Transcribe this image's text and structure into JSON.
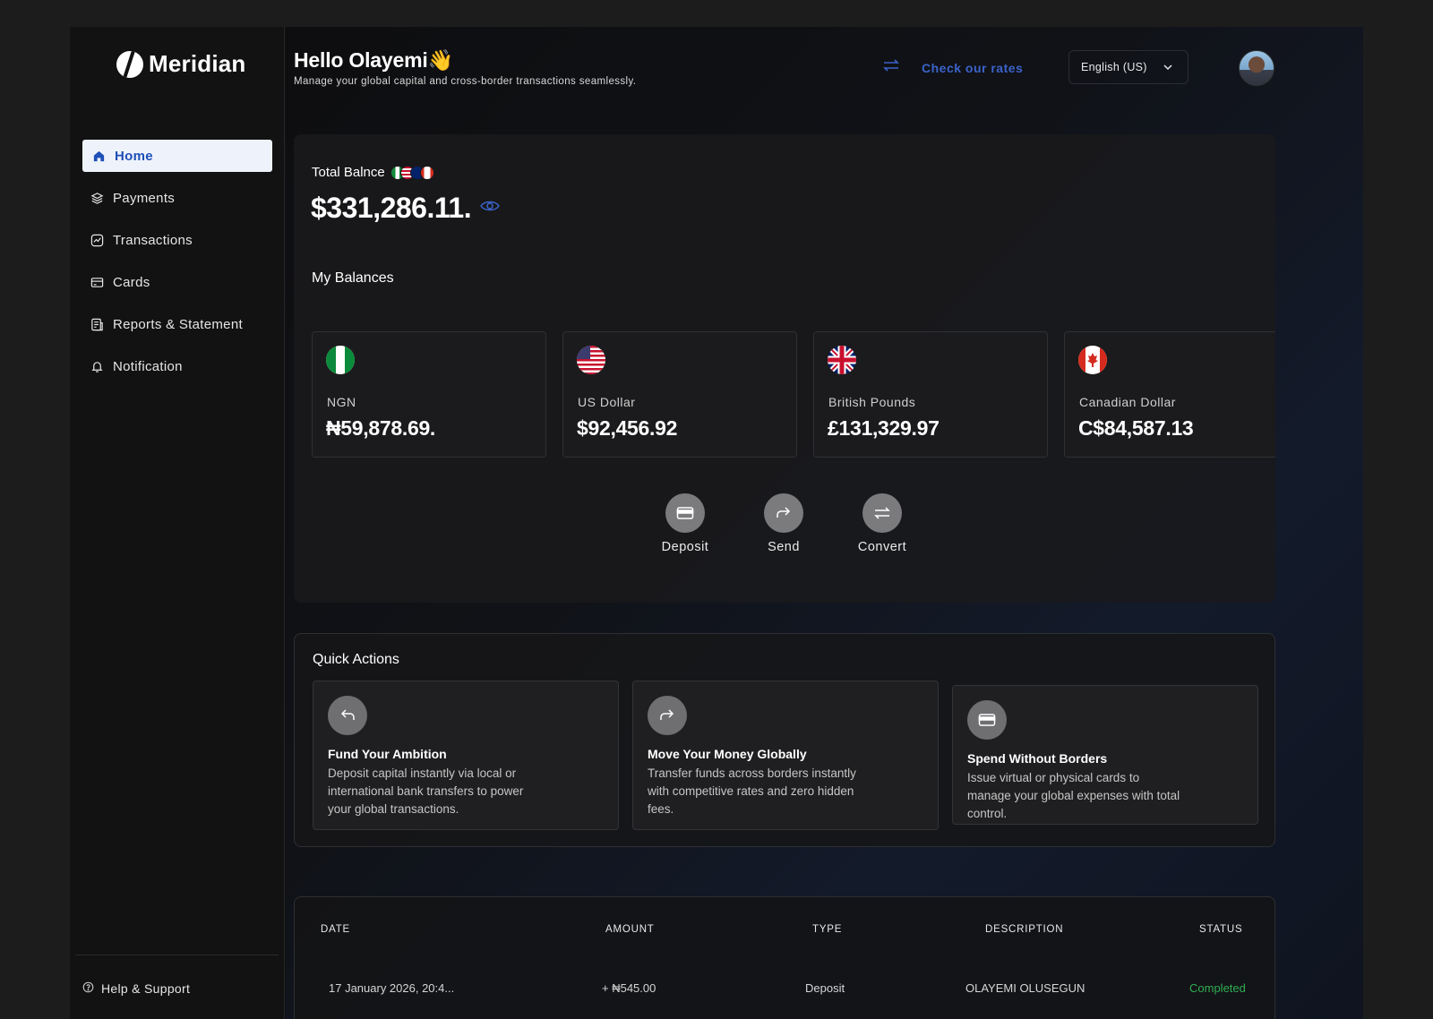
{
  "brand": {
    "name": "Meridian"
  },
  "sidebar": {
    "items": [
      {
        "label": "Home",
        "icon": "home-icon",
        "active": true
      },
      {
        "label": "Payments",
        "icon": "layers-icon"
      },
      {
        "label": "Transactions",
        "icon": "chart-icon"
      },
      {
        "label": "Cards",
        "icon": "card-icon"
      },
      {
        "label": "Reports & Statement",
        "icon": "report-icon"
      },
      {
        "label": "Notification",
        "icon": "bell-icon"
      }
    ],
    "help": "Help & Support"
  },
  "header": {
    "greeting": "Hello Olayemi👋",
    "subtitle": "Manage your global capital and cross-border transactions seamlessly.",
    "rates_link": "Check our rates",
    "language": "English (US)"
  },
  "balance": {
    "label": "Total Balnce",
    "amount": "$331,286.11.",
    "my_balances_title": "My Balances",
    "tiles": [
      {
        "name": "NGN",
        "value": "₦59,878.69.",
        "flag": "nigeria-flag"
      },
      {
        "name": "US Dollar",
        "value": "$92,456.92",
        "flag": "usa-flag"
      },
      {
        "name": "British Pounds",
        "value": "£131,329.97",
        "flag": "uk-flag"
      },
      {
        "name": "Canadian Dollar",
        "value": "C$84,587.13",
        "flag": "canada-flag"
      }
    ],
    "actions": [
      {
        "label": "Deposit",
        "icon": "wallet-icon"
      },
      {
        "label": "Send",
        "icon": "forward-arrow-icon"
      },
      {
        "label": "Convert",
        "icon": "swap-icon"
      }
    ]
  },
  "quick_actions": {
    "title": "Quick Actions",
    "items": [
      {
        "title": "Fund Your Ambition",
        "desc": "Deposit capital instantly via local or international bank transfers to power your global transactions.",
        "icon": "reply-arrow-icon"
      },
      {
        "title": "Move Your Money Globally",
        "desc": "Transfer funds across borders instantly with competitive rates and zero hidden fees.",
        "icon": "forward-arrow-icon"
      },
      {
        "title": "Spend Without Borders",
        "desc": "Issue virtual or physical cards to manage your global expenses with total control.",
        "icon": "wallet-icon"
      }
    ]
  },
  "transactions": {
    "headers": [
      "DATE",
      "AMOUNT",
      "TYPE",
      "DESCRIPTION",
      "STATUS"
    ],
    "rows": [
      {
        "date": "17 January 2026, 20:4...",
        "amount": "+ ₦545.00",
        "type": "Deposit",
        "description": "OLAYEMI OLUSEGUN",
        "status": "Completed"
      }
    ]
  },
  "colors": {
    "accent": "#3b63c9",
    "success": "#2fae52",
    "background": "#111112"
  }
}
